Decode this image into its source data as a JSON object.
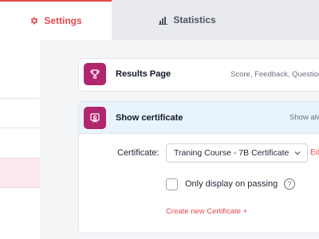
{
  "tabs": {
    "settings": {
      "label": "Settings",
      "icon": "gear-icon",
      "active": true,
      "color": "#e5484d"
    },
    "statistics": {
      "label": "Statistics",
      "icon": "bar-chart-icon",
      "active": false
    }
  },
  "results_card": {
    "title": "Results Page",
    "description": "Score, Feedback, Question",
    "icon": "trophy-icon",
    "badge_color": "#b0276d"
  },
  "certificate_card": {
    "title": "Show certificate",
    "description": "Show alw",
    "icon": "certificate-icon",
    "certificate_label": "Certificate:",
    "certificate_value": "Traning Course - 7B Certificate",
    "edit_label": "Ed",
    "checkbox_label": "Only display on passing",
    "checkbox_checked": false,
    "help_icon": "question-circle-icon",
    "create_link": "Create new Certificate +"
  }
}
